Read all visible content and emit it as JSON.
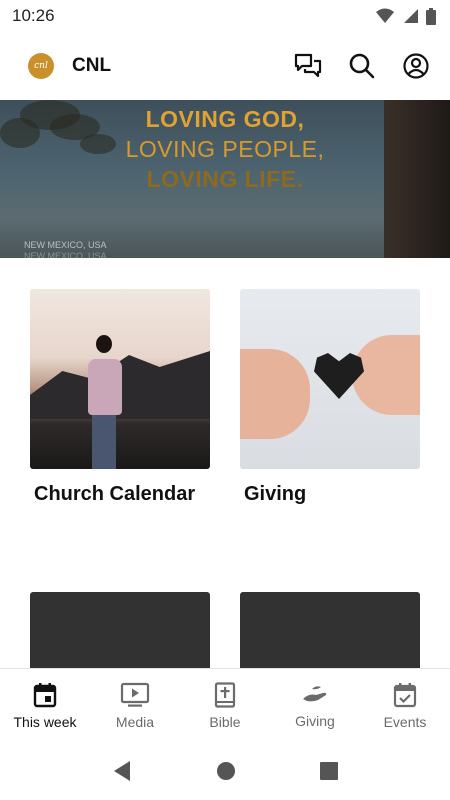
{
  "status_bar": {
    "time": "10:26"
  },
  "app_bar": {
    "logo_text": "cnl",
    "title": "CNL"
  },
  "hero": {
    "line1": "LOVING GOD,",
    "line2": "LOVING PEOPLE,",
    "line3": "LOVING LIFE.",
    "location": "NEW MEXICO, USA"
  },
  "cards": [
    {
      "label": "Church Calendar"
    },
    {
      "label": "Giving"
    },
    {
      "label": ""
    },
    {
      "label": ""
    }
  ],
  "bottom_nav": {
    "items": [
      {
        "label": "This week",
        "icon": "calendar-today-icon",
        "active": true
      },
      {
        "label": "Media",
        "icon": "play-screen-icon",
        "active": false
      },
      {
        "label": "Bible",
        "icon": "book-cross-icon",
        "active": false
      },
      {
        "label": "Giving",
        "icon": "hand-icon",
        "active": false
      },
      {
        "label": "Events",
        "icon": "calendar-check-icon",
        "active": false
      }
    ]
  },
  "colors": {
    "accent_gold": "#e0a232",
    "nav_active": "#111111",
    "nav_inactive": "#6b6b6b",
    "logo_bg": "#c9902c"
  }
}
